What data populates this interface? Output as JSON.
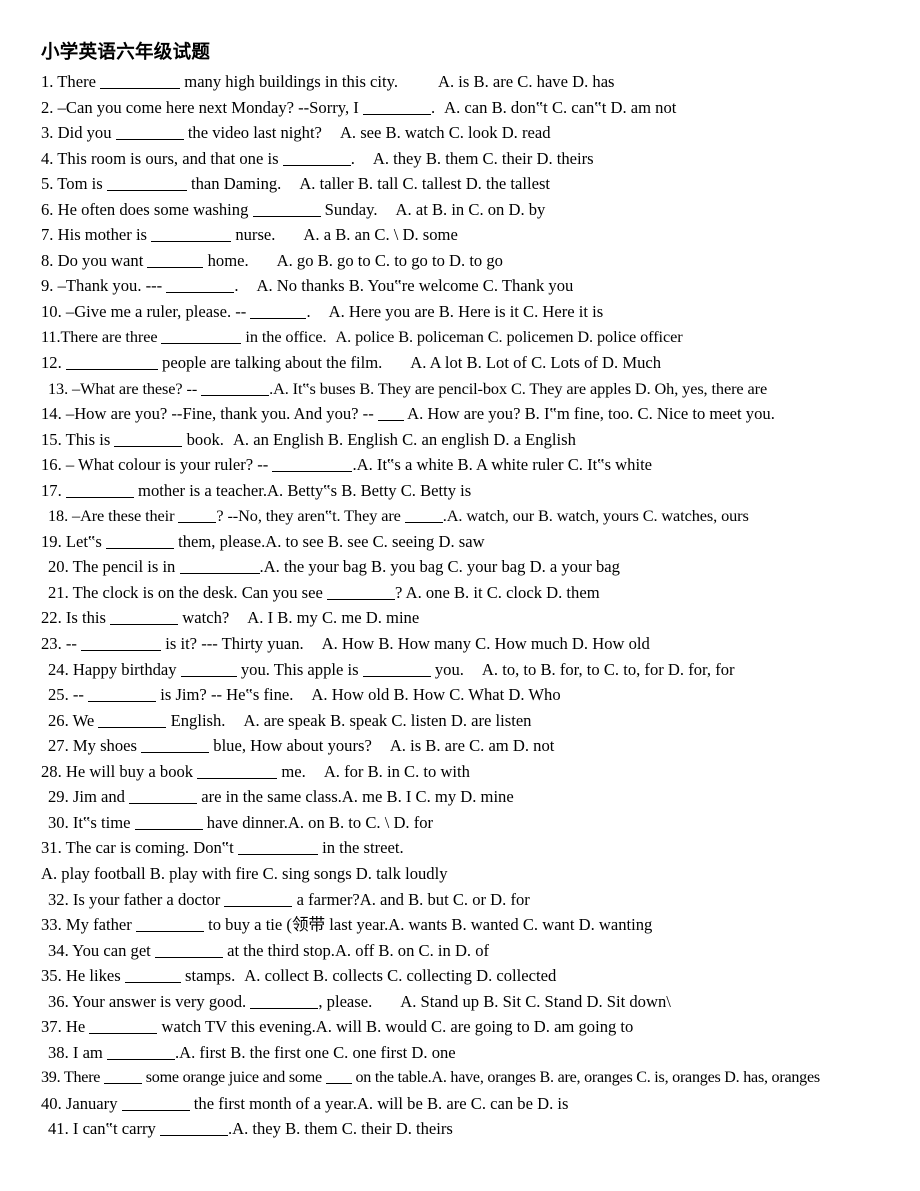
{
  "document": {
    "title": "小学英语六年级试题",
    "language": "zh-CN / en",
    "page_background": "#ffffff",
    "text_color": "#000000"
  },
  "questions": [
    {
      "number": "1.",
      "indent": false,
      "stem_before": "There",
      "blank": "xl",
      "stem_after": "many high buildings in this city.",
      "gap": "gap4",
      "options": "A. is    B. are    C. have    D. has",
      "full_text": "1. There ________ many high buildings in this city.     A. is   B. are   C. have   D. has"
    },
    {
      "number": "2.",
      "indent": false,
      "stem_before": "–Can you come here next Monday? --Sorry, I",
      "blank": "lg",
      "stem_after": ".",
      "gap": "gap1",
      "options": "A. can    B. don‟t    C. can‟t    D. am not",
      "full_text": "2. –Can you come here next Monday? --Sorry, I________.  A. can   B. don‟t   C. can‟t   D. am not"
    },
    {
      "number": "3.",
      "indent": false,
      "stem_before": "Did you",
      "blank": "lg",
      "stem_after": "the video last night?",
      "gap": "gap2",
      "options": "A. see    B. watch    C. look    D. read",
      "full_text": "3. Did you ________ the video last night?    A. see   B. watch   C. look   D. read"
    },
    {
      "number": "4.",
      "indent": false,
      "stem_before": "This room is ours, and that one is",
      "blank": "lg",
      "stem_after": ".",
      "gap": "gap2",
      "options": "A. they    B. them    C. their    D. theirs",
      "full_text": "4. This room is ours, and that one is ________.   A. they   B. them   C. their   D. theirs"
    },
    {
      "number": "5.",
      "indent": false,
      "stem_before": "Tom is",
      "blank": "xl",
      "stem_after": "than Daming.",
      "gap": "gap2",
      "options": "A. taller   B. tall   C. tallest   D. the tallest",
      "full_text": "5. Tom is __________ than Daming.   A. taller  B. tall  C. tallest  D. the tallest"
    },
    {
      "number": "6.",
      "indent": false,
      "stem_before": "He often does some washing",
      "blank": "lg",
      "stem_after": "Sunday.",
      "gap": "gap2",
      "options": "A. at    B. in    C. on    D. by",
      "full_text": "6. He often does some washing ________ Sunday.   A. at   B. in   C. on   D. by"
    },
    {
      "number": "7.",
      "indent": false,
      "stem_before": "His mother is",
      "blank": "xl",
      "stem_after": "nurse.",
      "gap": "gap3",
      "options": "A. a    B. an    C. \\    D. some",
      "full_text": "7. His mother is __________ nurse.     A. a   B. an   C. \\   D. some"
    },
    {
      "number": "8.",
      "indent": false,
      "stem_before": "Do you want",
      "blank": "md",
      "stem_after": "home.",
      "gap": "gap3",
      "options": "A. go    B. go to    C. to go to   D. to go",
      "full_text": "8. Do you want _______ home.    A. go   B. go to   C. to go to  D. to go"
    },
    {
      "number": "9.",
      "indent": false,
      "stem_before": "–Thank you. ---",
      "blank": "lg",
      "stem_after": ".",
      "gap": "gap2",
      "options": "A. No thanks    B. You‟re welcome    C. Thank you",
      "full_text": "9. –Thank you. --- ________.   A. No thanks   B. You‟re welcome   C. Thank you"
    },
    {
      "number": "10.",
      "indent": false,
      "stem_before": "–Give me a ruler, please. --",
      "blank": "md",
      "stem_after": ".",
      "gap": "gap2",
      "options": "A. Here you are    B. Here is it   C. Here it is",
      "full_text": "10. –Give me a ruler, please. --________.   A. Here you are   B. Here is it  C. Here it is"
    },
    {
      "number": "11.",
      "indent": false,
      "stem_before": "There are three",
      "blank": "xl",
      "stem_after": "in the office.",
      "gap": "gap1",
      "options": "A. police     B. policeman    C. policemen     D. police officer",
      "full_text": "11.There are three _________ in the office.  A. police   B. policeman  C. policemen   D. police officer"
    },
    {
      "number": "12.",
      "indent": false,
      "stem_before": "",
      "blank": "xxl",
      "stem_after": "people are talking about the film.",
      "gap": "gap3",
      "options": "A. A lot     B. Lot of     C. Lots of     D. Much",
      "full_text": "12. ________ people are talking about the film.    A. A lot    B. Lot of    C. Lots of    D. Much"
    },
    {
      "number": "13.",
      "indent": true,
      "stem_before": "–What are these? --",
      "blank": "lg",
      "stem_after": ".A. It‟s buses B. They are pencil-box C. They are apples D. Oh, yes, there are",
      "gap": "",
      "options": "",
      "full_text": "13. –What are these? --________.A. It‟s buses B. They are pencil-box C. They are apples D. Oh, yes, there are"
    },
    {
      "number": "14.",
      "indent": false,
      "stem_before": "–How are you? --Fine, thank you. And you? --",
      "blank": "xs",
      "stem_after": "A. How are you? B. I‟m fine, too. C. Nice to meet you.",
      "gap": "",
      "options": "",
      "full_text": "14. –How are you? --Fine, thank you. And you? --____A. How are you? B. I‟m fine, too. C. Nice to meet you."
    },
    {
      "number": "15.",
      "indent": false,
      "stem_before": "This is",
      "blank": "lg",
      "stem_after": "book.",
      "gap": "gap1",
      "options": "A. an English B. English C. an english D. a English",
      "full_text": "15. This is ________ book.  A. an English B. English C. an english D. a English"
    },
    {
      "number": "16.",
      "indent": false,
      "stem_before": "– What colour is your ruler? --",
      "blank": "xl",
      "stem_after": ".A. It‟s a white B. A white ruler C. It‟s white",
      "gap": "",
      "options": "",
      "full_text": "16. – What colour is your ruler? -- __________.A. It‟s a white B. A white ruler C. It‟s white"
    },
    {
      "number": "17.",
      "indent": false,
      "stem_before": "",
      "blank": "lg",
      "stem_after": "mother is a teacher.A. Betty‟s B. Betty C. Betty is",
      "gap": "",
      "options": "",
      "full_text": "17. ________ mother is a teacher.A. Betty‟s B. Betty C. Betty is"
    },
    {
      "number": "18.",
      "indent": true,
      "stem_before": "–Are these their",
      "blank": "sm",
      "stem_after": "? --No, they aren‟t. They are",
      "blank2": "sm",
      "stem_after2": ".A. watch, our B. watch, yours C. watches, ours",
      "gap": "",
      "options": "",
      "full_text": "18. –Are these their _____ ? --No, they aren‟t. They are _____.A. watch, our B. watch, yours C. watches, ours"
    },
    {
      "number": "19.",
      "indent": false,
      "stem_before": "Let‟s",
      "blank": "lg",
      "stem_after": "them, please.A. to see B. see C. seeing D. saw",
      "gap": "",
      "options": "",
      "full_text": "19. Let‟s ________ them, please.A. to see B. see C. seeing D. saw"
    },
    {
      "number": "20.",
      "indent": true,
      "stem_before": "The pencil is in",
      "blank": "xl",
      "stem_after": ".A. the your bag B. you bag C. your bag D. a your bag",
      "gap": "",
      "options": "",
      "full_text": "20. The pencil is in __________.A. the your bag B. you bag C. your bag D. a your bag"
    },
    {
      "number": "21.",
      "indent": true,
      "stem_before": "The clock is on the desk. Can you see",
      "blank": "lg",
      "stem_after": "?  A. one B. it C. clock D. them",
      "gap": "",
      "options": "",
      "full_text": "21. The clock is on the desk. Can you see ________?  A. one B. it C. clock D. them"
    },
    {
      "number": "22.",
      "indent": false,
      "stem_before": "Is this",
      "blank": "lg",
      "stem_after": "watch?",
      "gap": "gap2",
      "options": "A. I B. my C. me D. mine",
      "full_text": "22. Is this ________ watch?   A. I B. my C. me D. mine"
    },
    {
      "number": "23.",
      "indent": false,
      "stem_before": "--",
      "blank": "xl",
      "stem_after": "is it? --- Thirty yuan.",
      "gap": "gap2",
      "options": "A. How B. How many C. How much D. How old",
      "full_text": "23. --________ is it? --- Thirty yuan.   A. How B. How many C. How much D. How old"
    },
    {
      "number": "24.",
      "indent": true,
      "stem_before": "Happy birthday",
      "blank": "md",
      "stem_after": "you. This apple is",
      "blank2": "lg",
      "stem_after2": "you.",
      "gap": "gap2",
      "options": "A. to, to B. for, to C. to, for D. for, for",
      "full_text": "24. Happy birthday _______ you. This apple is ________ you.   A. to, to B. for, to C. to, for D. for, for"
    },
    {
      "number": "25.",
      "indent": true,
      "stem_before": "--",
      "blank": "lg",
      "stem_after": "is Jim? -- He‟s fine.",
      "gap": "gap2",
      "options": "A. How old B. How C. What D. Who",
      "full_text": "25. --________ is Jim? -- He‟s fine.   A. How old B. How C. What D. Who"
    },
    {
      "number": "26.",
      "indent": true,
      "stem_before": "We",
      "blank": "lg",
      "stem_after": "English.",
      "gap": "gap2",
      "options": "A. are speak B. speak C. listen D. are listen",
      "full_text": "26. We ________ English.   A. are speak B. speak C. listen D. are listen"
    },
    {
      "number": "27.",
      "indent": true,
      "stem_before": "My shoes",
      "blank": "lg",
      "stem_after": "blue, How about yours?",
      "gap": "gap2",
      "options": "A. is B. are C. am D. not",
      "full_text": "27. My shoes ________ blue, How about yours?   A. is B. are C. am D. not"
    },
    {
      "number": "28.",
      "indent": false,
      "stem_before": "He will buy a book",
      "blank": "xl",
      "stem_after": "me.",
      "gap": "gap2",
      "options": "A. for     B. in    C. to with",
      "full_text": "28. He will buy a book __________ me.   A. for    B. in   C. to with"
    },
    {
      "number": "29.",
      "indent": true,
      "stem_before": "Jim and",
      "blank": "lg",
      "stem_after": "are in the same class.A. me B. I C. my D. mine",
      "gap": "",
      "options": "",
      "full_text": "29. Jim and ________ are in the same class.A. me B. I C. my D. mine"
    },
    {
      "number": "30.",
      "indent": true,
      "stem_before": "It‟s time",
      "blank": "lg",
      "stem_after": "have dinner.A. on B. to C. \\ D. for",
      "gap": "",
      "options": "",
      "full_text": "30. It‟s time ________ have dinner.A. on B. to C. \\ D. for"
    },
    {
      "number": "31.",
      "indent": false,
      "stem_before": "The car is coming. Don‟t",
      "blank": "xl",
      "stem_after": "in the street.",
      "gap": "",
      "options": "",
      "full_text": "31. The car is coming. Don‟t __________ in the street."
    },
    {
      "number": "",
      "indent": false,
      "stem_before": "A. play football B. play with fire C. sing songs D. talk loudly",
      "blank": "",
      "stem_after": "",
      "gap": "",
      "options": "",
      "full_text": "A. play football B. play with fire C. sing songs D. talk loudly"
    },
    {
      "number": "32.",
      "indent": true,
      "stem_before": "Is your father a doctor",
      "blank": "lg",
      "stem_after": "a farmer?A. and B. but C. or D. for",
      "gap": "",
      "options": "",
      "full_text": "32. Is your father a doctor _________ a farmer?A. and B. but C. or D. for"
    },
    {
      "number": "33.",
      "indent": false,
      "stem_before": "My father",
      "blank": "lg",
      "stem_after": "to buy a tie (领带 last year.A. wants B. wanted C. want D. wanting",
      "gap": "",
      "options": "",
      "chinese_gloss": "领带",
      "full_text": "33. My father ________ to buy a tie (领带 last year.A. wants B. wanted C. want D. wanting"
    },
    {
      "number": "34.",
      "indent": true,
      "stem_before": "You can get",
      "blank": "lg",
      "stem_after": "at the third stop.A. off B. on C. in D. of",
      "gap": "",
      "options": "",
      "full_text": "34. You can get ________ at the third stop.A. off B. on C. in D. of"
    },
    {
      "number": "35.",
      "indent": false,
      "stem_before": "He likes",
      "blank": "md",
      "stem_after": "stamps.",
      "gap": "gap1",
      "options": "A. collect B. collects C. collecting D. collected",
      "full_text": "35. He likes ______ stamps.  A. collect B. collects C. collecting D. collected"
    },
    {
      "number": "36.",
      "indent": true,
      "stem_before": "Your answer is very good.",
      "blank": "lg",
      "stem_after": ", please.",
      "gap": "gap3",
      "options": "A. Stand up B. Sit C. Stand D. Sit down\\",
      "full_text": "36. Your answer is very good. _________, please.    A. Stand up B. Sit C. Stand D. Sit down\\"
    },
    {
      "number": "37.",
      "indent": false,
      "stem_before": "He",
      "blank": "lg",
      "stem_after": "watch TV this evening.A. will B. would C. are going to D. am going to",
      "gap": "",
      "options": "",
      "full_text": "37. He ________ watch TV this evening.A. will B. would C. are going to D. am going to"
    },
    {
      "number": "38.",
      "indent": true,
      "stem_before": "I am",
      "blank": "lg",
      "stem_after": ".A. first B. the first one C. one first D. one",
      "gap": "",
      "options": "",
      "full_text": "38. I am ________.A. first B. the first one C. one first D. one"
    },
    {
      "number": "39.",
      "indent": false,
      "stem_before": "There",
      "blank": "sm",
      "stem_after": "some orange juice and some",
      "blank2": "xs",
      "stem_after2": "on the table.A. have, oranges B. are, oranges C. is, oranges D. has, oranges",
      "gap": "",
      "options": "",
      "full_text": "39. There ____ some orange juice and some ___ on the table.A. have, oranges B. are, oranges C. is, oranges D. has, oranges"
    },
    {
      "number": "40.",
      "indent": false,
      "stem_before": "January",
      "blank": "lg",
      "stem_after": "the first month of a year.A. will be B. are C. can be D. is",
      "gap": "",
      "options": "",
      "full_text": "40. January _________ the first month of a year.A. will be B. are C. can be D. is"
    },
    {
      "number": "41.",
      "indent": true,
      "stem_before": "I can‟t carry",
      "blank": "lg",
      "stem_after": ".A. they B. them C. their D. theirs",
      "gap": "",
      "options": "",
      "full_text": "41. I can‟t carry _________.A. they B. them C. their D. theirs"
    }
  ]
}
